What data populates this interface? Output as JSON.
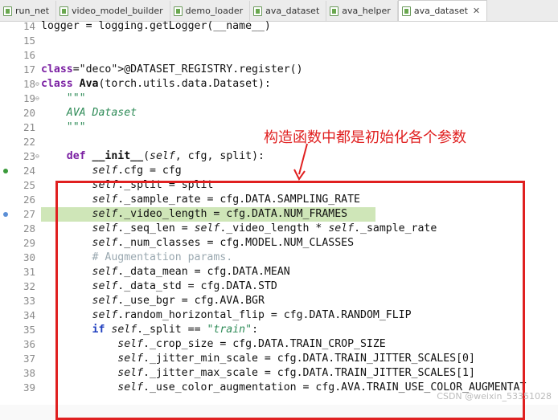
{
  "tabs": [
    {
      "label": "run_net",
      "active": false
    },
    {
      "label": "video_model_builder",
      "active": false
    },
    {
      "label": "demo_loader",
      "active": false
    },
    {
      "label": "ava_dataset",
      "active": false
    },
    {
      "label": "ava_helper",
      "active": false
    },
    {
      "label": "ava_dataset",
      "active": true
    }
  ],
  "tab_close_glyph": "✕",
  "lines": [
    {
      "n": "14",
      "code": "logger = logging.getLogger(__name__)"
    },
    {
      "n": "15",
      "code": ""
    },
    {
      "n": "16",
      "code": ""
    },
    {
      "n": "17",
      "code": "@DATASET_REGISTRY.register()"
    },
    {
      "n": "18",
      "code": "class Ava(torch.utils.data.Dataset):"
    },
    {
      "n": "19",
      "code": "    \"\"\""
    },
    {
      "n": "20",
      "code": "    AVA Dataset"
    },
    {
      "n": "21",
      "code": "    \"\"\""
    },
    {
      "n": "22",
      "code": ""
    },
    {
      "n": "23",
      "code": "    def __init__(self, cfg, split):"
    },
    {
      "n": "24",
      "code": "        self.cfg = cfg"
    },
    {
      "n": "25",
      "code": "        self._split = split"
    },
    {
      "n": "26",
      "code": "        self._sample_rate = cfg.DATA.SAMPLING_RATE"
    },
    {
      "n": "27",
      "code": "        self._video_length = cfg.DATA.NUM_FRAMES"
    },
    {
      "n": "28",
      "code": "        self._seq_len = self._video_length * self._sample_rate"
    },
    {
      "n": "29",
      "code": "        self._num_classes = cfg.MODEL.NUM_CLASSES"
    },
    {
      "n": "30",
      "code": "        # Augmentation params."
    },
    {
      "n": "31",
      "code": "        self._data_mean = cfg.DATA.MEAN"
    },
    {
      "n": "32",
      "code": "        self._data_std = cfg.DATA.STD"
    },
    {
      "n": "33",
      "code": "        self._use_bgr = cfg.AVA.BGR"
    },
    {
      "n": "34",
      "code": "        self.random_horizontal_flip = cfg.DATA.RANDOM_FLIP"
    },
    {
      "n": "35",
      "code": "        if self._split == \"train\":"
    },
    {
      "n": "36",
      "code": "            self._crop_size = cfg.DATA.TRAIN_CROP_SIZE"
    },
    {
      "n": "37",
      "code": "            self._jitter_min_scale = cfg.DATA.TRAIN_JITTER_SCALES[0]"
    },
    {
      "n": "38",
      "code": "            self._jitter_max_scale = cfg.DATA.TRAIN_JITTER_SCALES[1]"
    },
    {
      "n": "39",
      "code": "            self._use_color_augmentation = cfg.AVA.TRAIN_USE_COLOR_AUGMENTAT"
    }
  ],
  "highlighted_line": "27",
  "annotation": {
    "text": "构造函数中都是初始化各个参数",
    "color": "#e02020"
  },
  "watermark": "CSDN @weixin_53351028"
}
